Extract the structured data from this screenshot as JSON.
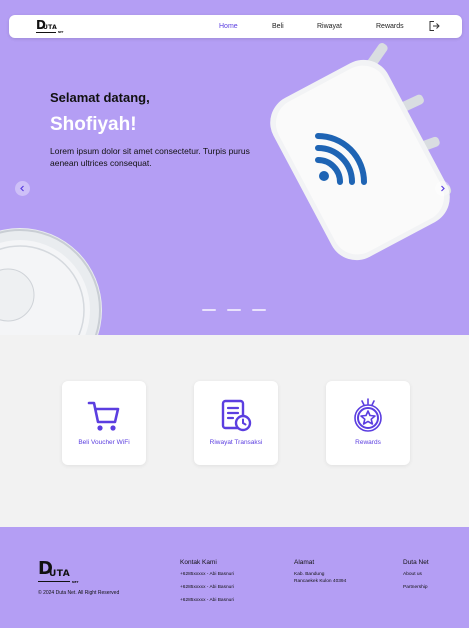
{
  "nav": {
    "logo_text": "UTA",
    "logo_sub": "NET",
    "links": [
      "Home",
      "Beli",
      "Riwayat",
      "Rewards"
    ],
    "active": "Home"
  },
  "hero": {
    "greeting": "Selamat datang,",
    "name": "Shofiyah!",
    "description": "Lorem ipsum dolor sit amet consectetur. Turpis purus aenean ultrices consequat."
  },
  "cards": [
    {
      "label": "Beli Voucher WiFi",
      "icon": "cart-icon"
    },
    {
      "label": "Riwayat Transaksi",
      "icon": "history-document-icon"
    },
    {
      "label": "Rewards",
      "icon": "rewards-star-icon"
    }
  ],
  "footer": {
    "logo_text": "UTA",
    "logo_sub": "NET",
    "copyright": "© 2024 Duta Net. All Right Reserved",
    "kontak": {
      "title": "Kontak Kami",
      "items": [
        "+6285xxxxx - Abi Basnuri",
        "+6285xxxxx - Abi Basnuri",
        "+6285xxxxx - Abi Basnuri"
      ]
    },
    "alamat": {
      "title": "Alamat",
      "lines": [
        "Kab. Bandung",
        "Rancaekek Kulon 40394"
      ]
    },
    "dutanet": {
      "title": "Duta Net",
      "items": [
        "About us",
        "Partnership"
      ]
    }
  },
  "colors": {
    "primary": "#5b3ee0",
    "hero_bg": "#b49ef4",
    "section_bg": "#f2f2f2",
    "wifi_blue": "#1e64b4"
  }
}
